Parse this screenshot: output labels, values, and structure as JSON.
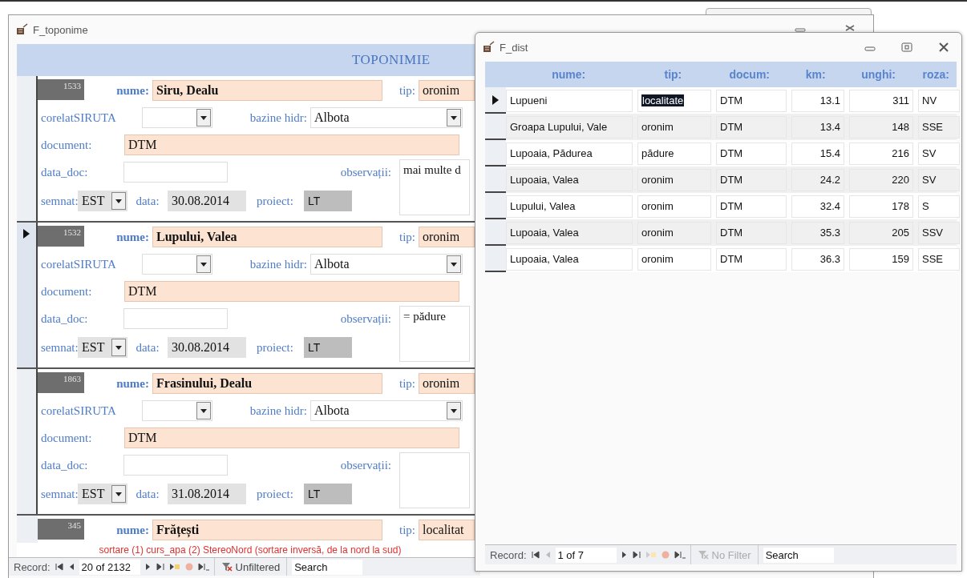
{
  "toponime_window": {
    "title": "F_toponime",
    "header": "TOPONIMIE",
    "records": [
      {
        "id": "1533",
        "current": false,
        "labels": {
          "nume": "nume:",
          "tip": "tip:",
          "corelat": "corelatSIRUTA",
          "bazine": "bazine hidr:",
          "document": "document:",
          "data_doc": "data_doc:",
          "observatii": "observații:",
          "semnat": "semnat:",
          "data": "data:",
          "proiect": "proiect:"
        },
        "nume": "Siru, Dealu",
        "tip": "oronim",
        "bazine_hidr": "Albota",
        "document": "DTM",
        "observatii": "mai multe d",
        "semnat": "EST",
        "data": "30.08.2014",
        "proiect": "LT"
      },
      {
        "id": "1532",
        "current": true,
        "labels": {
          "nume": "nume:",
          "tip": "tip:",
          "corelat": "corelatSIRUTA",
          "bazine": "bazine hidr:",
          "document": "document:",
          "data_doc": "data_doc:",
          "observatii": "observații:",
          "semnat": "semnat:",
          "data": "data:",
          "proiect": "proiect:"
        },
        "nume": "Lupului, Valea",
        "tip": "oronim",
        "bazine_hidr": "Albota",
        "document": "DTM",
        "observatii": "= pădure",
        "semnat": "EST",
        "data": "30.08.2014",
        "proiect": "LT"
      },
      {
        "id": "1863",
        "current": false,
        "labels": {
          "nume": "nume:",
          "tip": "tip:",
          "corelat": "corelatSIRUTA",
          "bazine": "bazine hidr:",
          "document": "document:",
          "data_doc": "data_doc:",
          "observatii": "observații:",
          "semnat": "semnat:",
          "data": "data:",
          "proiect": "proiect:"
        },
        "nume": "Frasinului, Dealu",
        "tip": "oronim",
        "bazine_hidr": "Albota",
        "document": "DTM",
        "semnat": "EST",
        "data": "31.08.2014",
        "proiect": "LT"
      }
    ],
    "partial_record": {
      "id": "345",
      "labels": {
        "nume": "nume:",
        "tip": "tip:"
      },
      "nume": "Frățești",
      "tip": "localitat"
    },
    "note": "sortare (1) curs_apa (2) StereoNord (sortare inversă, de la nord la sud)",
    "nav": {
      "label": "Record:",
      "position": "20 of 2132",
      "filter": "Unfiltered",
      "filter_enabled": true,
      "search": "Search"
    }
  },
  "dist_window": {
    "title": "F_dist",
    "columns": [
      "nume:",
      "tip:",
      "docum:",
      "km:",
      "unghi:",
      "roza:"
    ],
    "rows": [
      {
        "selected": true,
        "nume": "Lupueni",
        "tip": "localitate",
        "docum": "DTM",
        "km": "13.1",
        "unghi": "311",
        "roza": "NV"
      },
      {
        "selected": false,
        "nume": "Groapa Lupului, Vale",
        "tip": "oronim",
        "docum": "DTM",
        "km": "13.4",
        "unghi": "148",
        "roza": "SSE"
      },
      {
        "selected": false,
        "nume": "Lupoaia, Pădurea",
        "tip": "pădure",
        "docum": "DTM",
        "km": "15.4",
        "unghi": "216",
        "roza": "SV"
      },
      {
        "selected": false,
        "nume": "Lupoaia, Valea",
        "tip": "oronim",
        "docum": "DTM",
        "km": "24.2",
        "unghi": "220",
        "roza": "SV"
      },
      {
        "selected": false,
        "nume": "Lupului, Valea",
        "tip": "oronim",
        "docum": "DTM",
        "km": "32.4",
        "unghi": "178",
        "roza": "S"
      },
      {
        "selected": false,
        "nume": "Lupoaia, Valea",
        "tip": "oronim",
        "docum": "DTM",
        "km": "35.3",
        "unghi": "205",
        "roza": "SSV"
      },
      {
        "selected": false,
        "nume": "Lupoaia, Valea",
        "tip": "oronim",
        "docum": "DTM",
        "km": "36.3",
        "unghi": "159",
        "roza": "SSE"
      }
    ],
    "nav": {
      "label": "Record:",
      "position": "1 of 7",
      "filter": "No Filter",
      "filter_enabled": false,
      "search": "Search"
    }
  }
}
